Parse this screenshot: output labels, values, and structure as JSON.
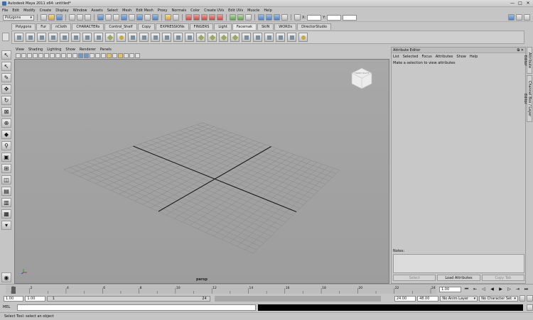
{
  "title": "Autodesk Maya 2011 x64: untitled*",
  "window_controls": [
    "—",
    "□",
    "✕"
  ],
  "menus": [
    "File",
    "Edit",
    "Modify",
    "Create",
    "Display",
    "Window",
    "Assets",
    "Select",
    "Mesh",
    "Edit Mesh",
    "Proxy",
    "Normals",
    "Color",
    "Create UVs",
    "Edit UVs",
    "Muscle",
    "Help"
  ],
  "status": {
    "mode": "Polygons",
    "field_x_label": "X:",
    "field_y_label": "Y:"
  },
  "shelf_tabs": [
    "Polygons",
    "Fur",
    "nCloth",
    "CHARACTERs",
    "Control_Shelf",
    "Copy",
    "EXPRESSIONs",
    "FINGERS",
    "Light",
    "Facemak",
    "SkIN",
    "WORDs",
    "DirectorStudio"
  ],
  "shelf_active": "Facemak",
  "panel_menu": [
    "View",
    "Shading",
    "Lighting",
    "Show",
    "Renderer",
    "Panels"
  ],
  "viewport": {
    "camera_label": "persp",
    "viewcube_label": "FRONT  RIGHT"
  },
  "attribute_editor": {
    "title": "Attribute Editor",
    "menu": [
      "List",
      "Selected",
      "Focus",
      "Attributes",
      "Show",
      "Help"
    ],
    "message": "Make a selection to view attributes",
    "notes_label": "Notes:",
    "buttons": {
      "select": "Select",
      "load": "Load Attributes",
      "copy": "Copy Tab"
    }
  },
  "side_tabs": [
    "Attribute Editor",
    "Channel Box / Layer Editor"
  ],
  "time_ticks": [
    "1",
    "2",
    "4",
    "6",
    "8",
    "10",
    "12",
    "14",
    "16",
    "18",
    "20",
    "22",
    "24"
  ],
  "current_frame": "1.00",
  "range": {
    "start": "1.00",
    "start2": "1.00",
    "slider_start": "1",
    "slider_end": "24",
    "end": "24.00",
    "end2": "48.00"
  },
  "anim_layer": "No Anim Layer",
  "character_set": "No Character Set",
  "command": {
    "label": "MEL"
  },
  "help_line": "Select Tool: select an object"
}
